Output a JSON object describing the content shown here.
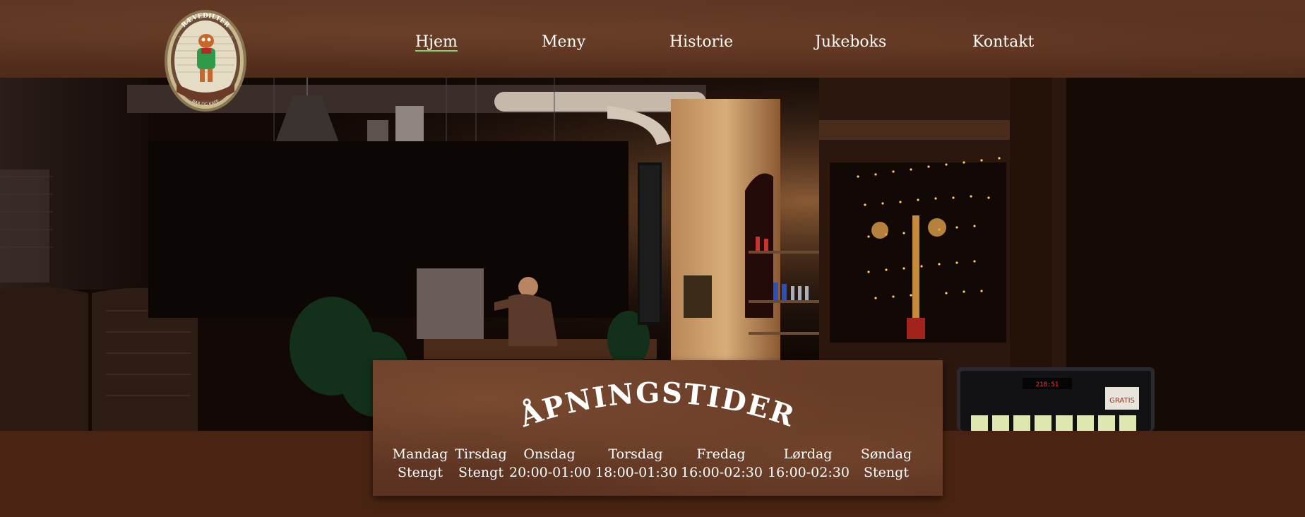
{
  "logo": {
    "top_text": "RÆVEDILTER",
    "bottom_text": "BAR OG KAFE"
  },
  "nav": {
    "items": [
      {
        "label": "Hjem",
        "active": true
      },
      {
        "label": "Meny",
        "active": false
      },
      {
        "label": "Historie",
        "active": false
      },
      {
        "label": "Jukeboks",
        "active": false
      },
      {
        "label": "Kontakt",
        "active": false
      }
    ]
  },
  "hero": {
    "jukebox_sign": "GRATIS",
    "jukebox_display": "218:51"
  },
  "hours": {
    "title": "ÅPNINGSTIDER",
    "days": [
      {
        "day": "Mandag",
        "time": "Stengt"
      },
      {
        "day": "Tirsdag",
        "time": "Stengt"
      },
      {
        "day": "Onsdag",
        "time": "20:00-01:00"
      },
      {
        "day": "Torsdag",
        "time": "18:00-01:30"
      },
      {
        "day": "Fredag",
        "time": "16:00-02:30"
      },
      {
        "day": "Lørdag",
        "time": "16:00-02:30"
      },
      {
        "day": "Søndag",
        "time": "Stengt"
      }
    ]
  },
  "colors": {
    "header_bg": "#5a3220",
    "page_bg": "#4a2412",
    "active_underline": "#7fd46a"
  }
}
